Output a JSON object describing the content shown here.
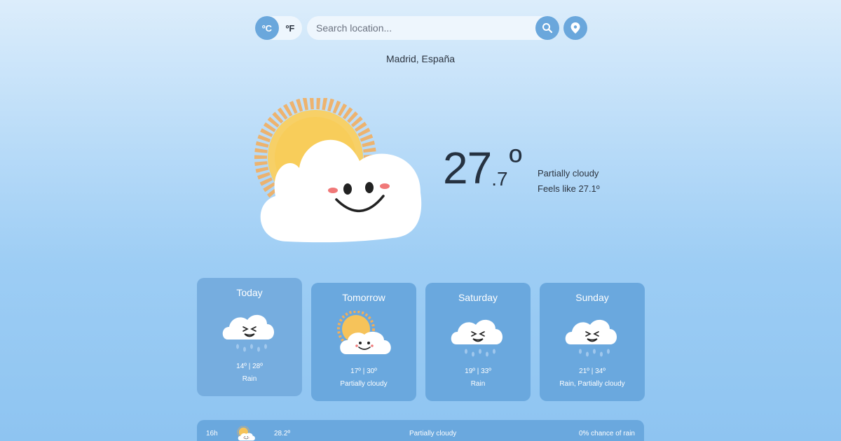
{
  "units": {
    "celsius": "ºC",
    "fahrenheit": "ºF",
    "selected": "celsius"
  },
  "search": {
    "placeholder": "Search location...",
    "value": ""
  },
  "location": "Madrid, España",
  "current": {
    "temp_int": "27",
    "temp_dec": ".7",
    "degree": "º",
    "condition": "Partially cloudy",
    "feels_like": "Feels like 27.1º",
    "icon": "sun-behind-smiling-cloud-icon"
  },
  "forecast": [
    {
      "day": "Today",
      "temps": "14º | 28º",
      "desc": "Rain",
      "icon": "rain-cloud-icon",
      "active": true
    },
    {
      "day": "Tomorrow",
      "temps": "17º | 30º",
      "desc": "Partially cloudy",
      "icon": "partly-cloudy-icon",
      "active": false
    },
    {
      "day": "Saturday",
      "temps": "19º | 33º",
      "desc": "Rain",
      "icon": "rain-cloud-icon",
      "active": false
    },
    {
      "day": "Sunday",
      "temps": "21º | 34º",
      "desc": "Rain, Partially cloudy",
      "icon": "rain-cloud-icon",
      "active": false
    }
  ],
  "hourly": [
    {
      "hour": "16h",
      "temp": "28.2º",
      "desc": "Partially cloudy",
      "rain": "0% chance of rain",
      "icon": "partly-cloudy-icon"
    }
  ],
  "colors": {
    "accent": "#6aa7dc",
    "card": "#6aa8de",
    "text": "#2c3440"
  }
}
